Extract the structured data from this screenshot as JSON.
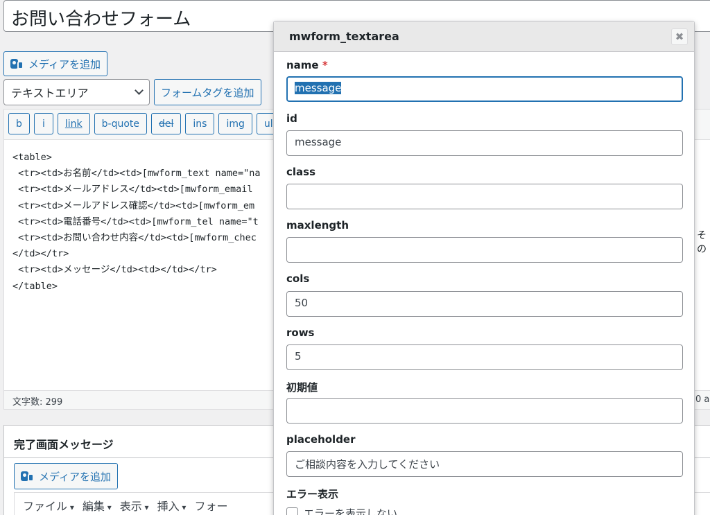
{
  "post": {
    "title": "お問い合わせフォーム"
  },
  "toolbar": {
    "add_media": "メディアを追加",
    "select_value": "テキストエリア",
    "add_form_tag": "フォームタグを追加"
  },
  "quicktags": [
    "b",
    "i",
    "link",
    "b-quote",
    "del",
    "ins",
    "img",
    "ul",
    ""
  ],
  "editor": {
    "lines": [
      "<table>",
      " <tr><td>お名前</td><td>[mwform_text name=\"na",
      " <tr><td>メールアドレス</td><td>[mwform_email",
      " <tr><td>メールアドレス確認</td><td>[mwform_em",
      " <tr><td>電話番号</td><td>[mwform_tel name=\"t",
      " <tr><td>お問い合わせ内容</td><td>[mwform_chec",
      "</td></tr>",
      " <tr><td>メッセージ</td><td></td></tr>",
      "</table>"
    ],
    "side_text": "その",
    "word_count": "文字数: 299",
    "status_right": "0 a"
  },
  "complete": {
    "title": "完了画面メッセージ",
    "add_media": "メディアを追加",
    "menus": [
      "ファイル",
      "編集",
      "表示",
      "挿入",
      "フォー"
    ]
  },
  "dialog": {
    "title": "mwform_textarea",
    "close_icon": "close-icon",
    "fields": {
      "name": {
        "label": "name",
        "required": "*",
        "value": "message"
      },
      "id": {
        "label": "id",
        "value": "message"
      },
      "class": {
        "label": "class",
        "value": ""
      },
      "maxlength": {
        "label": "maxlength",
        "value": ""
      },
      "cols": {
        "label": "cols",
        "value": "50"
      },
      "rows": {
        "label": "rows",
        "value": "5"
      },
      "initial": {
        "label": "初期値",
        "value": ""
      },
      "placeholder": {
        "label": "placeholder",
        "value": "ご相談内容を入力してください"
      }
    },
    "error_display": {
      "label": "エラー表示",
      "checkbox_label": "エラーを表示しない"
    }
  },
  "colors": {
    "accent": "#2271b1",
    "required": "#d63638"
  }
}
